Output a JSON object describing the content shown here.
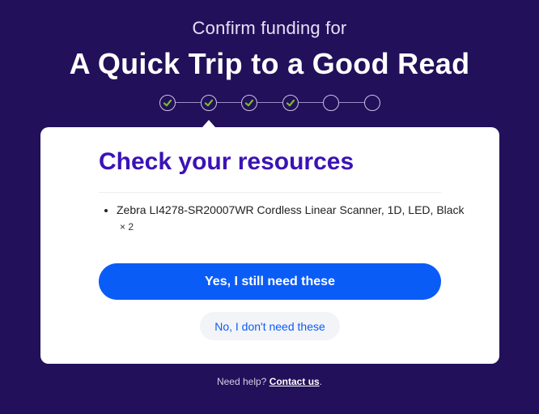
{
  "header": {
    "subtitle": "Confirm funding for",
    "title": "A Quick Trip to a Good Read"
  },
  "progress": {
    "total_steps": 6,
    "completed_steps": 4,
    "current_step": 2
  },
  "card": {
    "title": "Check your resources",
    "resources": [
      {
        "name": "Zebra LI4278-SR20007WR Cordless Linear Scanner, 1D, LED, Black",
        "quantity": "× 2"
      }
    ],
    "primary_button": "Yes, I still need these",
    "secondary_button": "No, I don't need these"
  },
  "help": {
    "prefix": "Need help?",
    "link": "Contact us",
    "suffix": "."
  },
  "colors": {
    "background": "#23105a",
    "accent": "#0a5cf7",
    "title": "#3b12b6",
    "check": "#7cb82f"
  }
}
